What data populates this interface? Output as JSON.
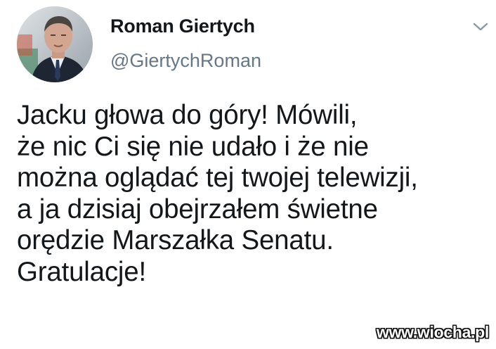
{
  "author": {
    "name": "Roman Giertych",
    "handle": "@GiertychRoman",
    "avatar_icon": "profile-photo"
  },
  "menu": {
    "icon": "chevron-down-icon"
  },
  "tweet": {
    "text": "Jacku głowa do góry! Mówili,\nże nic Ci się nie udało i że nie\nmożna oglądać tej twojej telewizji,\na ja dzisiaj obejrzałem świetne\norędzie Marszałka Senatu.\nGratulacje!"
  },
  "watermark": {
    "text": "www.wiocha.pl"
  },
  "colors": {
    "text": "#14171a",
    "handle": "#657786",
    "caret": "#8899a6",
    "background": "#ffffff"
  }
}
